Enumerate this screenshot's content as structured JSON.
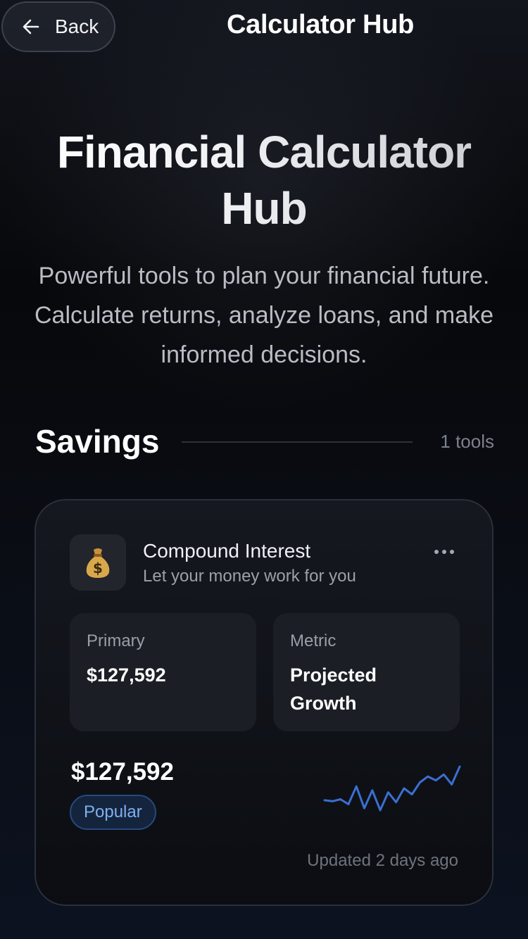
{
  "header": {
    "back_label": "Back",
    "title": "Calculator Hub"
  },
  "hero": {
    "title": "Financial Calculator Hub",
    "subtitle": "Powerful tools to plan your financial future. Calculate returns, analyze loans, and make informed decisions."
  },
  "section": {
    "title": "Savings",
    "count": "1 tools"
  },
  "card": {
    "icon": "money-bag-icon",
    "icon_glyph": "$",
    "title": "Compound Interest",
    "subtitle": "Let your money work for you",
    "primary_label": "Primary",
    "primary_value": "$127,592",
    "metric_label": "Metric",
    "metric_value": "Projected Growth",
    "big_value": "$127,592",
    "badge": "Popular",
    "updated": "Updated 2 days ago",
    "sparkline_color": "#3b6fd0",
    "sparkline_values": [
      30,
      29,
      31,
      26,
      44,
      22,
      40,
      20,
      38,
      28,
      42,
      36,
      48,
      54,
      50,
      56,
      46,
      64
    ]
  }
}
